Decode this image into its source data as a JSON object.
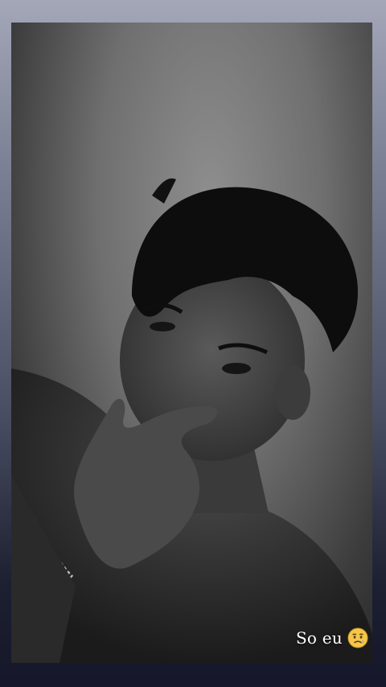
{
  "story": {
    "caption_text": "So eu",
    "caption_emoji": "disappointed-relieved-face-icon",
    "photo_description_icon": "person-selfie-photo"
  },
  "colors": {
    "frame_top": "#a3a7b8",
    "frame_bottom": "#15172a",
    "caption": "#ffffff",
    "emoji_face": "#f4c64a"
  }
}
